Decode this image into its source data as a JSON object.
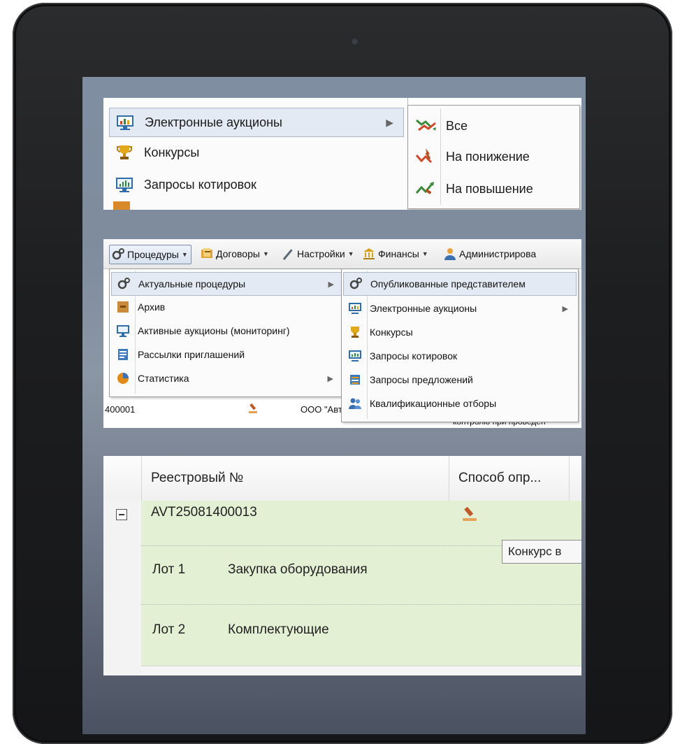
{
  "panel1": {
    "menu": [
      {
        "label": "Электронные аукционы",
        "icon": "auction-monitor-icon",
        "selected": true,
        "has_submenu": true
      },
      {
        "label": "Конкурсы",
        "icon": "trophy-icon"
      },
      {
        "label": "Запросы котировок",
        "icon": "quotes-monitor-icon"
      }
    ],
    "submenu": [
      {
        "label": "Все",
        "icon": "trend-both-icon"
      },
      {
        "label": "На понижение",
        "icon": "trend-down-icon"
      },
      {
        "label": "На повышение",
        "icon": "trend-up-icon"
      }
    ]
  },
  "panel2": {
    "toolbar": [
      {
        "label": "Процедуры",
        "icon": "gears-icon",
        "active": true
      },
      {
        "label": "Договоры",
        "icon": "contracts-icon"
      },
      {
        "label": "Настройки",
        "icon": "wrench-icon"
      },
      {
        "label": "Финансы",
        "icon": "bank-icon"
      },
      {
        "label": "Администрирова",
        "icon": "admin-user-icon"
      }
    ],
    "menu": [
      {
        "label": "Актуальные процедуры",
        "icon": "gears-icon",
        "selected": true,
        "has_submenu": true
      },
      {
        "label": "Архив",
        "icon": "archive-box-icon"
      },
      {
        "label": "Активные аукционы (мониторинг)",
        "icon": "monitor-icon"
      },
      {
        "label": "Рассылки приглашений",
        "icon": "mailing-icon"
      },
      {
        "label": "Статистика",
        "icon": "pie-chart-icon",
        "has_submenu": true
      }
    ],
    "submenu": [
      {
        "label": "Опубликованные представителем",
        "icon": "gears-icon",
        "selected": true
      },
      {
        "label": "Электронные аукционы",
        "icon": "auction-monitor-icon",
        "has_submenu": true
      },
      {
        "label": "Конкурсы",
        "icon": "trophy-icon"
      },
      {
        "label": "Запросы котировок",
        "icon": "quotes-monitor-icon"
      },
      {
        "label": "Запросы предложений",
        "icon": "proposals-icon"
      },
      {
        "label": "Квалификационные отборы",
        "icon": "users-icon"
      }
    ],
    "background": {
      "row_number": "400001",
      "org": "ООО \"Авт",
      "fragment": "контролю при проведен"
    }
  },
  "panel3": {
    "headers": {
      "reg_no": "Реестровый №",
      "method": "Способ опр..."
    },
    "record": {
      "reg_no": "AVT25081400013",
      "expander": "⊟"
    },
    "lots": [
      {
        "label": "Лот 1",
        "name": "Закупка оборудования"
      },
      {
        "label": "Лот 2",
        "name": "Комплектующие"
      }
    ],
    "tooltip": "Конкурс в"
  }
}
